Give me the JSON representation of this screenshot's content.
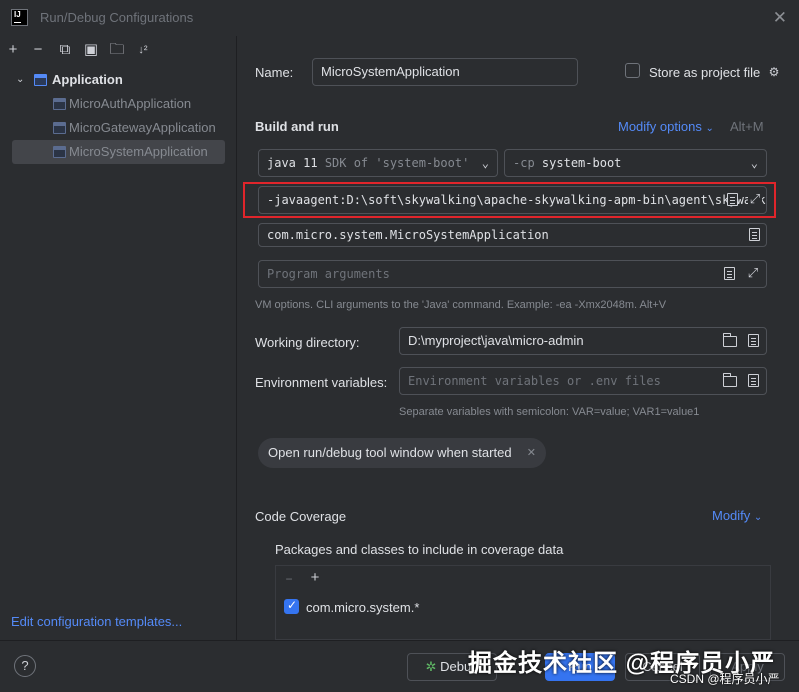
{
  "window": {
    "title": "Run/Debug Configurations",
    "app_icon_text": "IJ"
  },
  "toolbar": {
    "icons": [
      "add-icon",
      "remove-icon",
      "copy-icon",
      "save-icon",
      "new-folder-icon",
      "sort-icon"
    ]
  },
  "tree": {
    "root": "Application",
    "items": [
      "MicroAuthApplication",
      "MicroGatewayApplication",
      "MicroSystemApplication"
    ]
  },
  "left_footer": {
    "edit_templates": "Edit configuration templates..."
  },
  "form": {
    "name_label": "Name:",
    "name_value": "MicroSystemApplication",
    "store_label": "Store as project file",
    "build_run_title": "Build and run",
    "modify_options": "Modify options",
    "modify_shortcut": "Alt+M",
    "jdk_value": "java 11",
    "jdk_hint": "SDK of 'system-boot'",
    "cp_prefix": "-cp",
    "cp_value": "system-boot",
    "vm_options": "-javaagent:D:\\soft\\skywalking\\apache-skywalking-apm-bin\\agent\\skywalking-agent.jar",
    "main_class": "com.micro.system.MicroSystemApplication",
    "program_args_placeholder": "Program arguments",
    "vm_hint": "VM options. CLI arguments to the 'Java' command. Example: -ea -Xmx2048m. Alt+V",
    "working_dir_label": "Working directory:",
    "working_dir_value": "D:\\myproject\\java\\micro-admin",
    "env_label": "Environment variables:",
    "env_placeholder": "Environment variables or .env files",
    "env_hint": "Separate variables with semicolon: VAR=value; VAR1=value1",
    "chip_label": "Open run/debug tool window when started",
    "coverage_title": "Code Coverage",
    "coverage_modify": "Modify",
    "packages_label": "Packages and classes to include in coverage data",
    "package_item": "com.micro.system.*"
  },
  "buttons": {
    "help": "?",
    "debug": "Debug",
    "run": "Run",
    "cancel": "Cancel",
    "apply": "Apply"
  },
  "watermark": {
    "main": "掘金技术社区 @程序员小严",
    "sub": "CSDN @程序员小严"
  }
}
